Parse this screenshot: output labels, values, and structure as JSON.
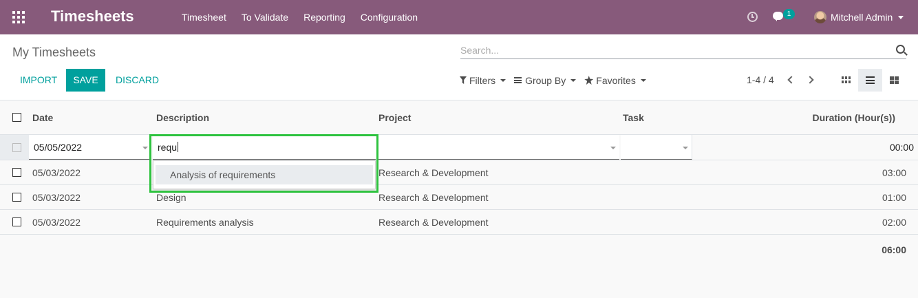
{
  "navbar": {
    "app_title": "Timesheets",
    "menu": [
      "Timesheet",
      "To Validate",
      "Reporting",
      "Configuration"
    ],
    "chat_count": "1",
    "user_name": "Mitchell Admin",
    "color": "#875a7b"
  },
  "control": {
    "page_title": "My Timesheets",
    "search_placeholder": "Search...",
    "import_label": "IMPORT",
    "save_label": "SAVE",
    "discard_label": "DISCARD",
    "filters_label": "Filters",
    "group_by_label": "Group By",
    "favorites_label": "Favorites",
    "pager": "1-4 / 4",
    "accent": "#00a09d"
  },
  "table": {
    "columns": [
      "Date",
      "Description",
      "Project",
      "Task",
      "Duration (Hour(s))"
    ],
    "edit_row": {
      "date": "05/05/2022",
      "description": "requ",
      "project": "",
      "task": "",
      "duration": "00:00"
    },
    "autocomplete_option": "Analysis of requirements",
    "rows": [
      {
        "date": "05/03/2022",
        "description": "",
        "project": "Research & Development",
        "task": "",
        "duration": "03:00"
      },
      {
        "date": "05/03/2022",
        "description": "Design",
        "project": "Research & Development",
        "task": "",
        "duration": "01:00"
      },
      {
        "date": "05/03/2022",
        "description": "Requirements analysis",
        "project": "Research & Development",
        "task": "",
        "duration": "02:00"
      }
    ],
    "total_duration": "06:00"
  },
  "highlight_color": "#2ec33f"
}
